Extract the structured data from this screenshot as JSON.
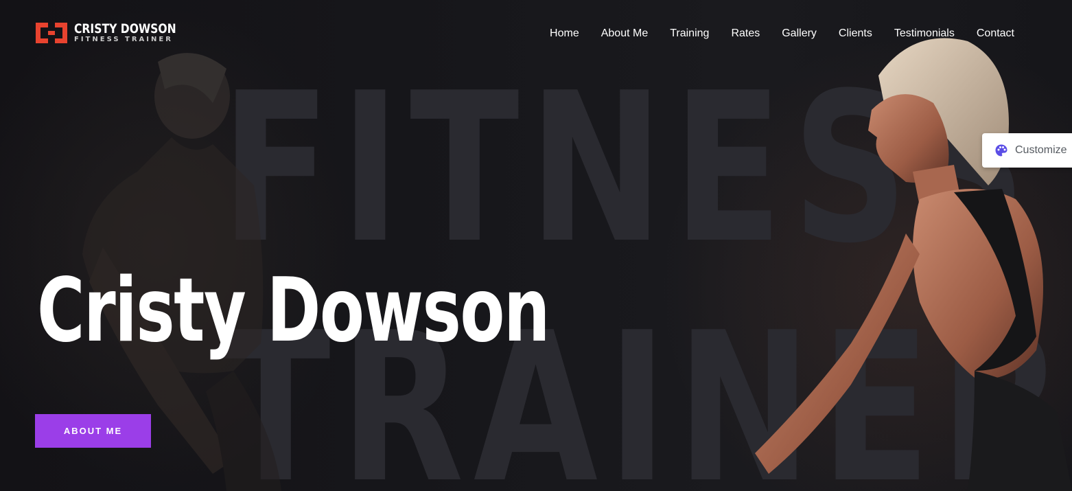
{
  "brand": {
    "name": "CRISTY DOWSON",
    "tagline": "FITNESS TRAINER",
    "logo_icon": "ch-monogram-icon",
    "accent_color": "#e8432f"
  },
  "nav": {
    "items": [
      {
        "label": "Home"
      },
      {
        "label": "About Me"
      },
      {
        "label": "Training"
      },
      {
        "label": "Rates"
      },
      {
        "label": "Gallery"
      },
      {
        "label": "Clients"
      },
      {
        "label": "Testimonials"
      },
      {
        "label": "Contact"
      }
    ]
  },
  "hero": {
    "background_word_1": "FITNESS",
    "background_word_2": "TRAINER",
    "title": "Cristy Dowson",
    "cta_label": "ABOUT ME",
    "cta_color": "#9b3ee8"
  },
  "customize": {
    "label": "Customize",
    "icon": "palette-icon",
    "icon_color": "#5b4ee6"
  }
}
